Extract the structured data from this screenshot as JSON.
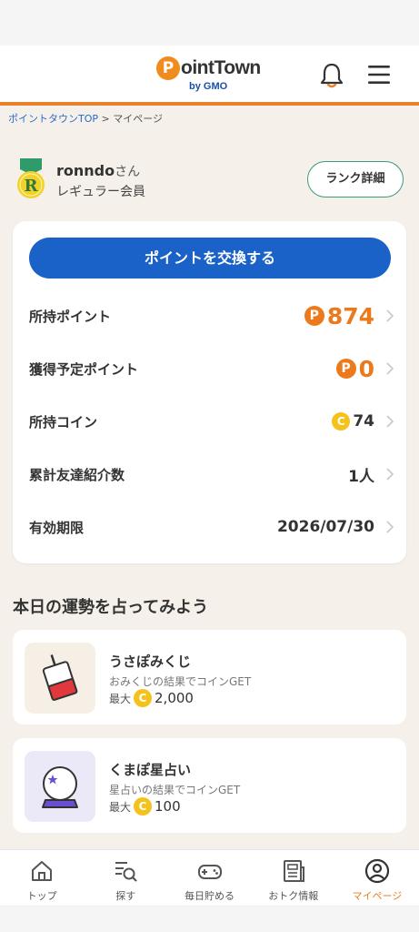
{
  "header": {
    "logo_mark": "P",
    "logo_text": "ointTown",
    "logo_sub": "by GMO"
  },
  "breadcrumb": {
    "home": "ポイントタウンTOP",
    "separator": " > ",
    "current": "マイページ"
  },
  "profile": {
    "rank_letter": "R",
    "username": "ronndo",
    "suffix": "さん",
    "member_type": "レギュラー会員",
    "rank_button": "ランク詳細"
  },
  "points_card": {
    "exchange_button": "ポイントを交換する",
    "rows": [
      {
        "label": "所持ポイント",
        "value": "874",
        "icon": "P"
      },
      {
        "label": "獲得予定ポイント",
        "value": "0",
        "icon": "P"
      },
      {
        "label": "所持コイン",
        "value": "74",
        "icon": "C"
      },
      {
        "label": "累計友達紹介数",
        "value": "1人"
      },
      {
        "label": "有効期限",
        "value": "2026/07/30"
      }
    ]
  },
  "fortune": {
    "section_title": "本日の運勢を占ってみよう",
    "items": [
      {
        "title": "うさぽみくじ",
        "desc": "おみくじの結果でコインGET",
        "max_label": "最大",
        "coin": "C",
        "amount": "2,000"
      },
      {
        "title": "くまぽ星占い",
        "desc": "星占いの結果でコインGET",
        "max_label": "最大",
        "coin": "C",
        "amount": "100"
      }
    ]
  },
  "bottom_nav": [
    {
      "label": "トップ",
      "icon": "home-icon"
    },
    {
      "label": "探す",
      "icon": "search-list-icon"
    },
    {
      "label": "毎日貯める",
      "icon": "gamepad-icon"
    },
    {
      "label": "おトク情報",
      "icon": "newspaper-icon"
    },
    {
      "label": "マイページ",
      "icon": "user-icon",
      "active": true
    }
  ],
  "colors": {
    "accent": "#e8822a",
    "primary_button": "#1a61c8",
    "rank_border": "#3a9a7a",
    "coin": "#f4c21a",
    "background": "#f5f1ea"
  }
}
